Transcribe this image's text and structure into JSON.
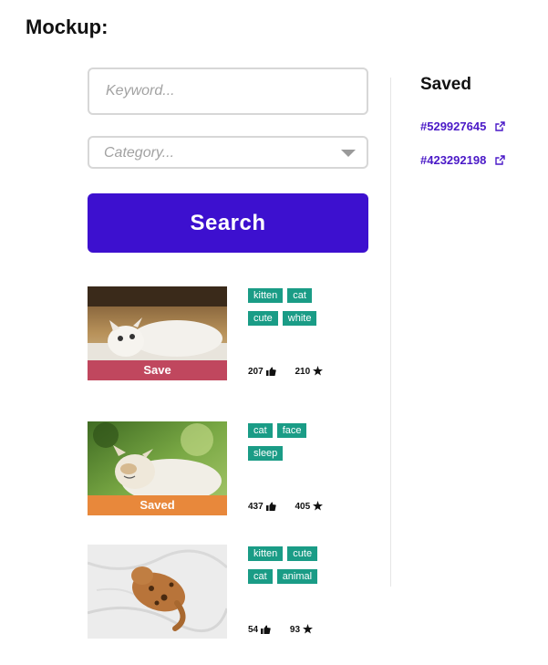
{
  "heading": "Mockup:",
  "search": {
    "keyword_placeholder": "Keyword...",
    "category_placeholder": "Category...",
    "button_label": "Search"
  },
  "results": [
    {
      "tags": [
        "kitten",
        "cat",
        "cute",
        "white"
      ],
      "action": "Save",
      "likes": "207",
      "stars": "210",
      "image": "white-kitten-photo"
    },
    {
      "tags": [
        "cat",
        "face",
        "sleep"
      ],
      "action": "Saved",
      "likes": "437",
      "stars": "405",
      "image": "sleeping-cat-photo"
    },
    {
      "tags": [
        "kitten",
        "cute",
        "cat",
        "animal"
      ],
      "action": "",
      "likes": "54",
      "stars": "93",
      "image": "bengal-kitten-photo"
    }
  ],
  "saved": {
    "title": "Saved",
    "items": [
      "#529927645",
      "#423292198"
    ]
  },
  "colors": {
    "primary": "#3d10cf",
    "save": "#c0475e",
    "saved": "#e8883b",
    "tag": "#1a9c86",
    "link": "#4a19c7"
  }
}
